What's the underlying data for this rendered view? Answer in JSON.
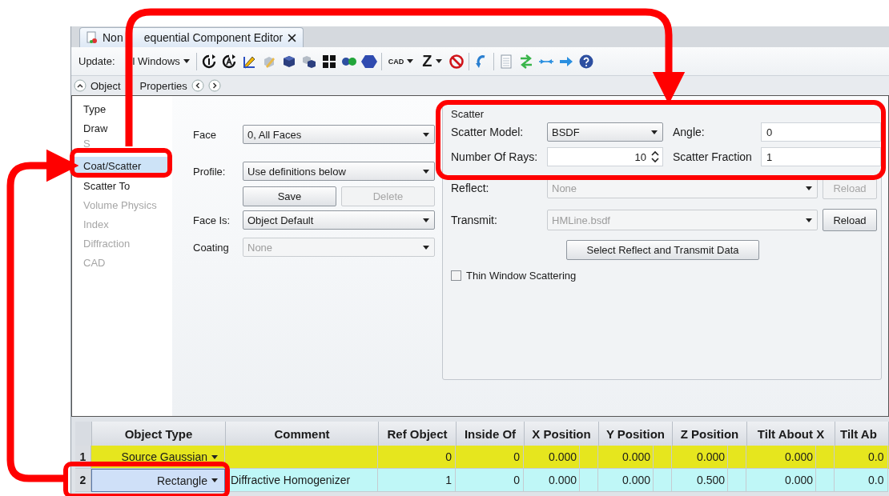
{
  "tab": {
    "title_parts": [
      "Non",
      "equential Component Editor"
    ]
  },
  "toolbar": {
    "update_parts": [
      "Update:",
      "l Windows"
    ],
    "cad": "CAD",
    "z": "Z"
  },
  "section": {
    "title_parts": [
      "Object",
      "Properties"
    ]
  },
  "sidebar": {
    "items": [
      {
        "label": "Type",
        "disabled": false,
        "selected": false
      },
      {
        "label": "Draw",
        "disabled": false,
        "selected": false
      },
      {
        "label": "S",
        "disabled": true,
        "selected": false
      },
      {
        "label": "Coat/Scatter",
        "disabled": false,
        "selected": true
      },
      {
        "label": "Scatter To",
        "disabled": false,
        "selected": false
      },
      {
        "label": "Volume Physics",
        "disabled": true,
        "selected": false
      },
      {
        "label": "Index",
        "disabled": true,
        "selected": false
      },
      {
        "label": "Diffraction",
        "disabled": true,
        "selected": false
      },
      {
        "label": "CAD",
        "disabled": true,
        "selected": false
      }
    ]
  },
  "face_form": {
    "rows": [
      {
        "kind": "dropdown",
        "label": "Face",
        "value": "0, All Faces",
        "disabled": false
      },
      {
        "kind": "dropdown",
        "label": "Profile:",
        "value": "Use definitions below",
        "disabled": false
      },
      {
        "kind": "buttons",
        "buttons": [
          {
            "label": "Save",
            "disabled": false
          },
          {
            "label": "Delete",
            "disabled": true
          }
        ]
      },
      {
        "kind": "dropdown",
        "label": "Face Is:",
        "value": "Object Default",
        "disabled": false
      },
      {
        "kind": "dropdown",
        "label": "Coating",
        "value": "None",
        "disabled": true
      }
    ]
  },
  "scatter": {
    "title": "Scatter",
    "model": {
      "label": "Scatter Model:",
      "value": "BSDF"
    },
    "angle": {
      "label": "Angle:",
      "value": "0"
    },
    "rays": {
      "label": "Number Of Rays:",
      "value": "10"
    },
    "fraction": {
      "label": "Scatter Fraction",
      "value": "1"
    },
    "files": [
      {
        "label": "Reflect:",
        "value": "None",
        "disabled": true,
        "button": {
          "label": "Reload",
          "disabled": true
        }
      },
      {
        "label": "Transmit:",
        "value": "HMLine.bsdf",
        "disabled": true,
        "button": {
          "label": "Reload",
          "disabled": false
        }
      }
    ],
    "select_button": "Select Reflect and Transmit Data",
    "thin_window": {
      "label": "Thin Window Scattering",
      "checked": false
    }
  },
  "table": {
    "columns": [
      "Object Type",
      "Comment",
      "Ref Object",
      "Inside Of",
      "X Position",
      "Y Position",
      "Z Position",
      "Tilt About X",
      "Tilt Ab"
    ],
    "rows": [
      {
        "number": "1",
        "color": "#e6e61e",
        "selected": false,
        "cells": [
          "Source Gaussian",
          "",
          "0",
          "0",
          "0.000",
          "0.000",
          "0.000",
          "0.000",
          "0.0"
        ]
      },
      {
        "number": "2",
        "color": "#bff7f7",
        "selected": true,
        "cells": [
          "Rectangle",
          "Diffractive Homogenizer",
          "1",
          "0",
          "0.000",
          "0.000",
          "0.500",
          "0.000",
          "0.0"
        ]
      }
    ]
  }
}
